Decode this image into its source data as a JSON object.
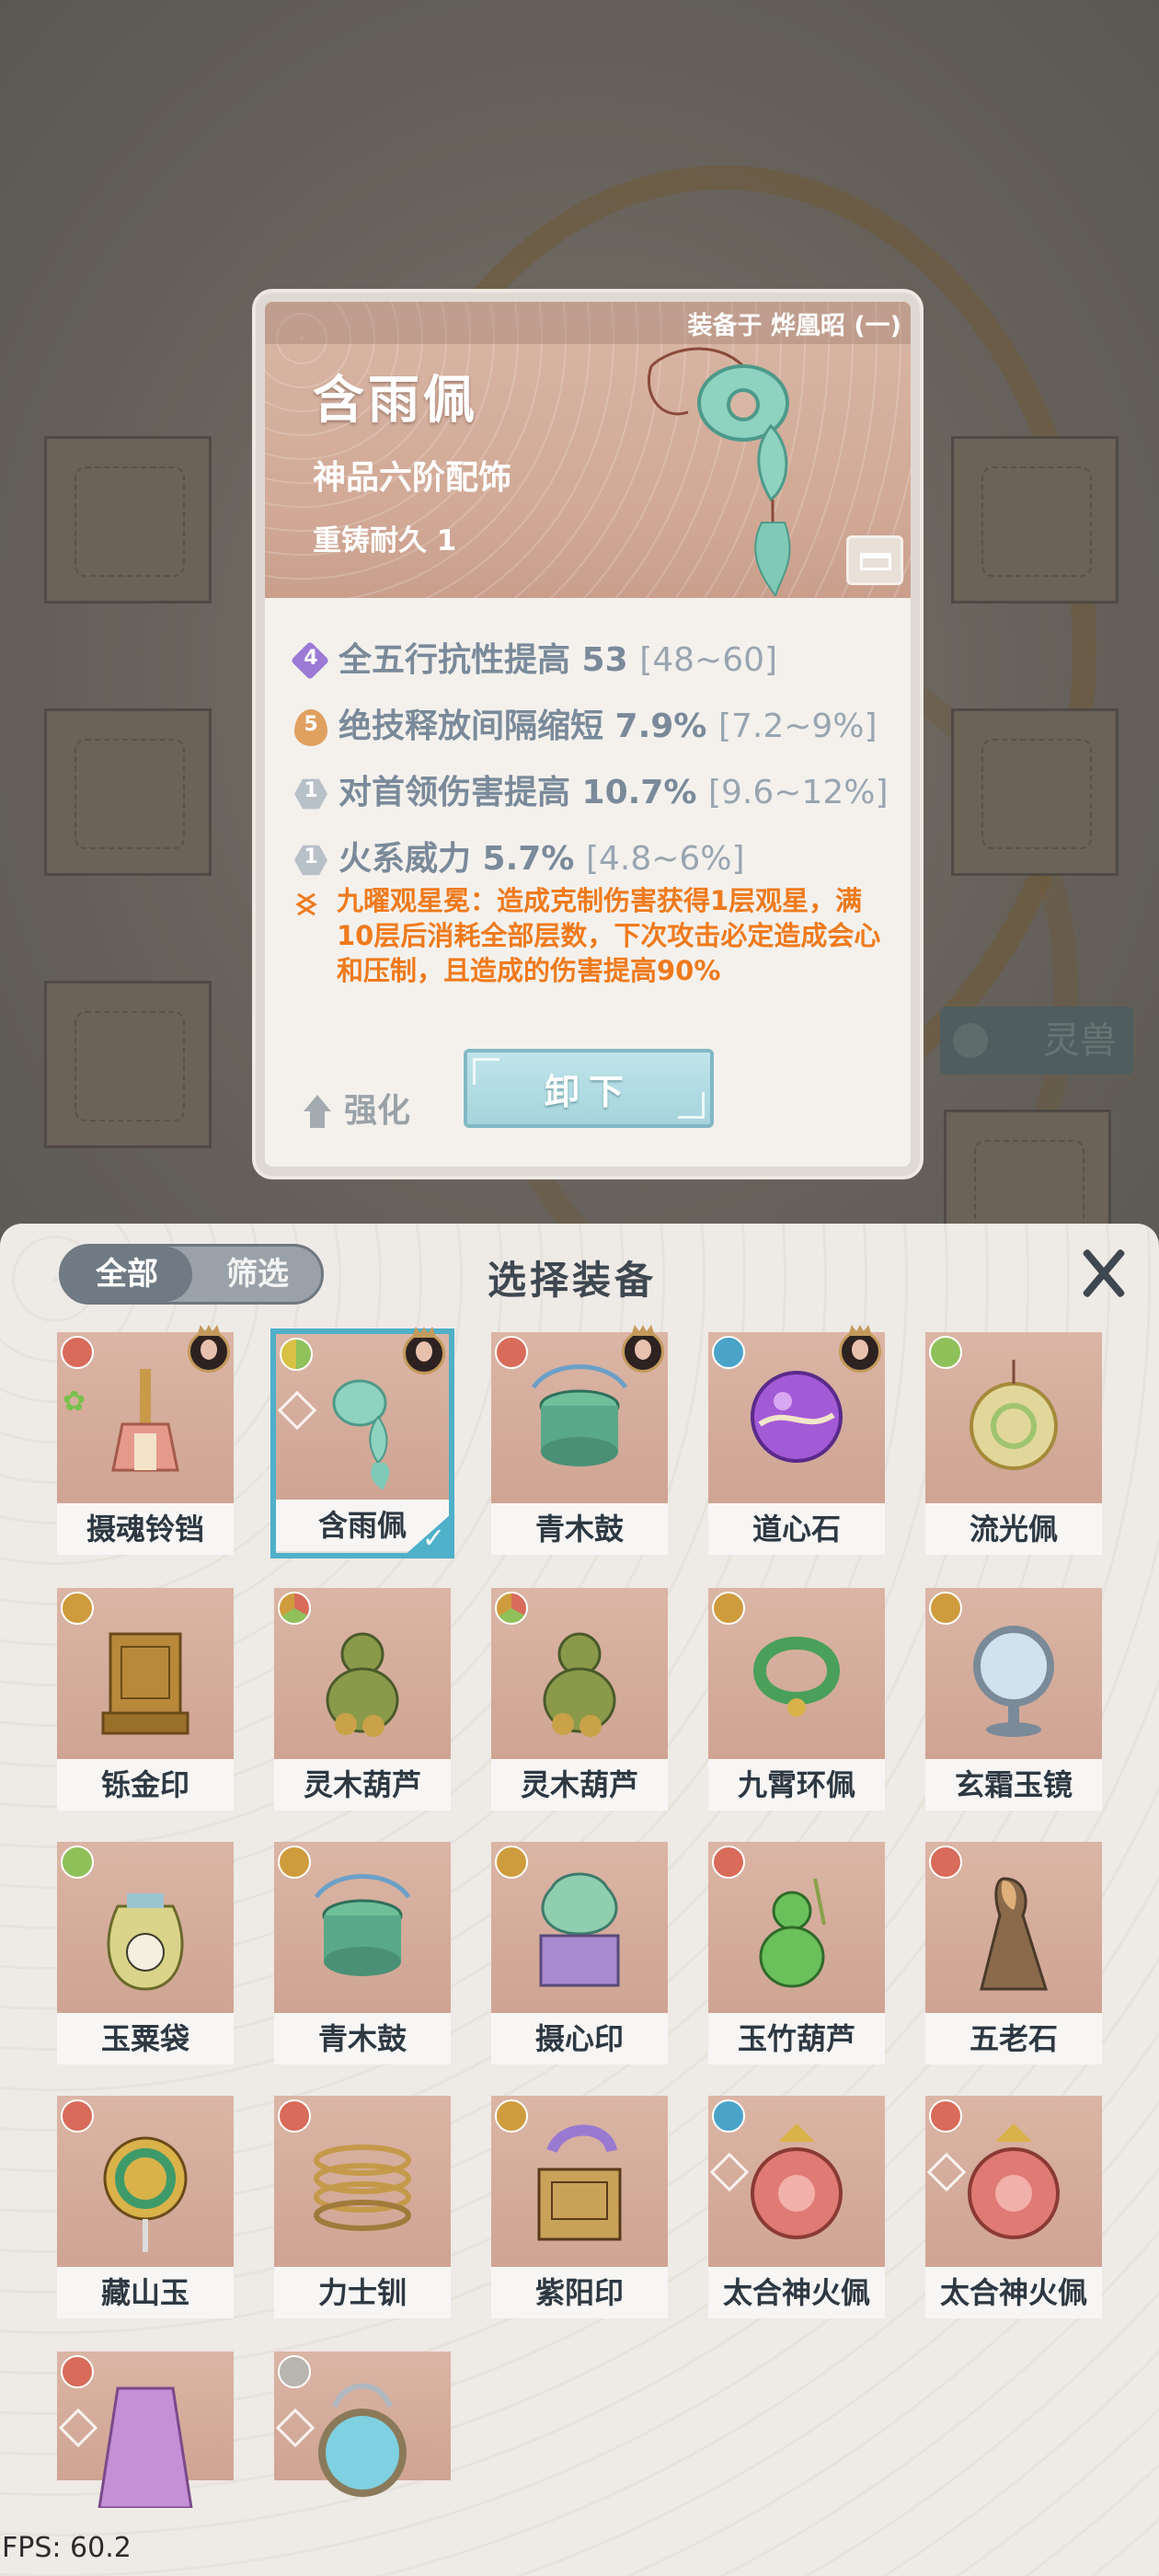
{
  "detail": {
    "equipped_text": "装备于 烨凰昭 (一)",
    "name": "含雨佩",
    "grade": "神品六阶配饰",
    "durability": "重铸耐久 1",
    "attributes": [
      {
        "level": "4",
        "text": "全五行抗性提高 53",
        "range": "[48~60]"
      },
      {
        "level": "5",
        "text": "绝技释放间隔缩短 7.9%",
        "range": "[7.2~9%]"
      },
      {
        "level": "1",
        "text": "对首领伤害提高 10.7%",
        "range": "[9.6~12%]"
      },
      {
        "level": "1",
        "text": "火系威力 5.7%",
        "range": "[4.8~6%]"
      }
    ],
    "skill_text": "九曜观星冕：造成克制伤害获得1层观星，满10层后消耗全部层数，下次攻击必定造成会心和压制，且造成的伤害提高90%",
    "enhance_label": "强化",
    "unequip_label": "卸下"
  },
  "background": {
    "beast_label": "灵兽"
  },
  "panel": {
    "tabs": [
      "全部",
      "筛选"
    ],
    "title": "选择装备",
    "items": [
      {
        "name": "摄魂铃铛",
        "element": "fire"
      },
      {
        "name": "含雨佩",
        "element": "wood",
        "selected": true
      },
      {
        "name": "青木鼓",
        "element": "fire"
      },
      {
        "name": "道心石",
        "element": "water"
      },
      {
        "name": "流光佩",
        "element": "wood"
      },
      {
        "name": "铄金印",
        "element": "earth"
      },
      {
        "name": "灵木葫芦",
        "element": "mix"
      },
      {
        "name": "灵木葫芦",
        "element": "mix"
      },
      {
        "name": "九霄环佩",
        "element": "earth"
      },
      {
        "name": "玄霜玉镜",
        "element": "earth"
      },
      {
        "name": "玉粟袋",
        "element": "wood"
      },
      {
        "name": "青木鼓",
        "element": "earth"
      },
      {
        "name": "摄心印",
        "element": "earth"
      },
      {
        "name": "玉竹葫芦",
        "element": "fire"
      },
      {
        "name": "五老石",
        "element": "fire"
      },
      {
        "name": "藏山玉",
        "element": "fire"
      },
      {
        "name": "力士钏",
        "element": "fire"
      },
      {
        "name": "紫阳印",
        "element": "earth"
      },
      {
        "name": "太合神火佩",
        "element": "water"
      },
      {
        "name": "太合神火佩",
        "element": "fire"
      },
      {
        "name": "",
        "element": "fire"
      },
      {
        "name": "",
        "element": "metal"
      }
    ]
  },
  "fps": "FPS: 60.2"
}
